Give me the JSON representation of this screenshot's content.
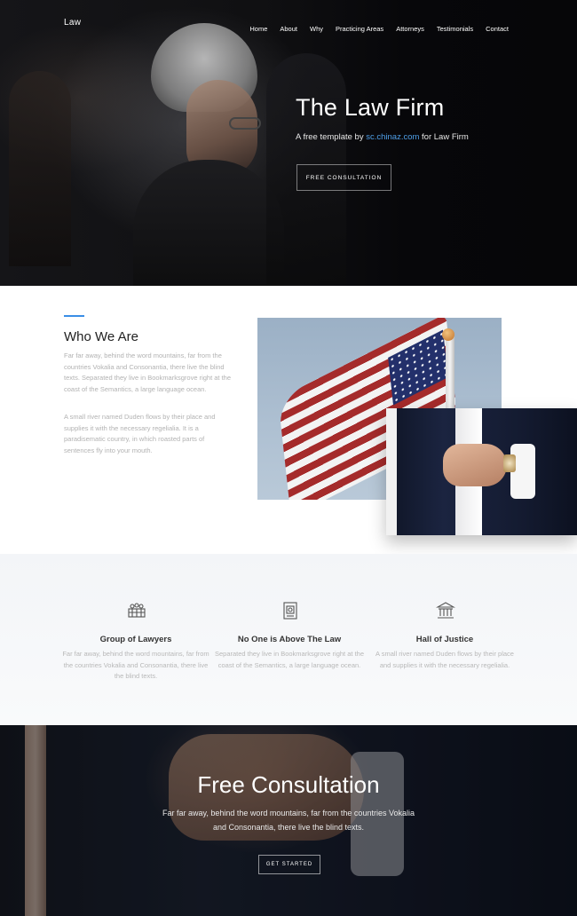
{
  "nav": {
    "brand": "Law",
    "links": [
      "Home",
      "About",
      "Why",
      "Practicing Areas",
      "Attorneys",
      "Testimonials",
      "Contact"
    ]
  },
  "hero": {
    "title": "The Law Firm",
    "subtitle_prefix": "A free template by ",
    "subtitle_link": "sc.chinaz.com",
    "subtitle_suffix": " for Law Firm",
    "button": "FREE CONSULTATION"
  },
  "about": {
    "title": "Who We Are",
    "paragraph1": "Far far away, behind the word mountains, far from the countries Vokalia and Consonantia, there live the blind texts. Separated they live in Bookmarksgrove right at the coast of the Semantics, a large language ocean.",
    "paragraph2": "A small river named Duden flows by their place and supplies it with the necessary regelialia. It is a paradisematic country, in which roasted parts of sentences fly into your mouth."
  },
  "features": [
    {
      "icon": "lawyers-group-icon",
      "title": "Group of Lawyers",
      "desc": "Far far away, behind the word mountains, far from the countries Vokalia and Consonantia, there live the blind texts."
    },
    {
      "icon": "law-document-icon",
      "title": "No One is Above The Law",
      "desc": "Separated they live in Bookmarksgrove right at the coast of the Semantics, a large language ocean."
    },
    {
      "icon": "courthouse-icon",
      "title": "Hall of Justice",
      "desc": "A small river named Duden flows by their place and supplies it with the necessary regelialia."
    }
  ],
  "consultation": {
    "title": "Free Consultation",
    "desc": "Far far away, behind the word mountains, far from the countries Vokalia and Consonantia, there live the blind texts.",
    "button": "GET STARTED"
  },
  "colors": {
    "accent": "#3a8ee6",
    "link": "#4f9fe8",
    "heading": "#222222",
    "muted_text": "#b2b2b2"
  }
}
